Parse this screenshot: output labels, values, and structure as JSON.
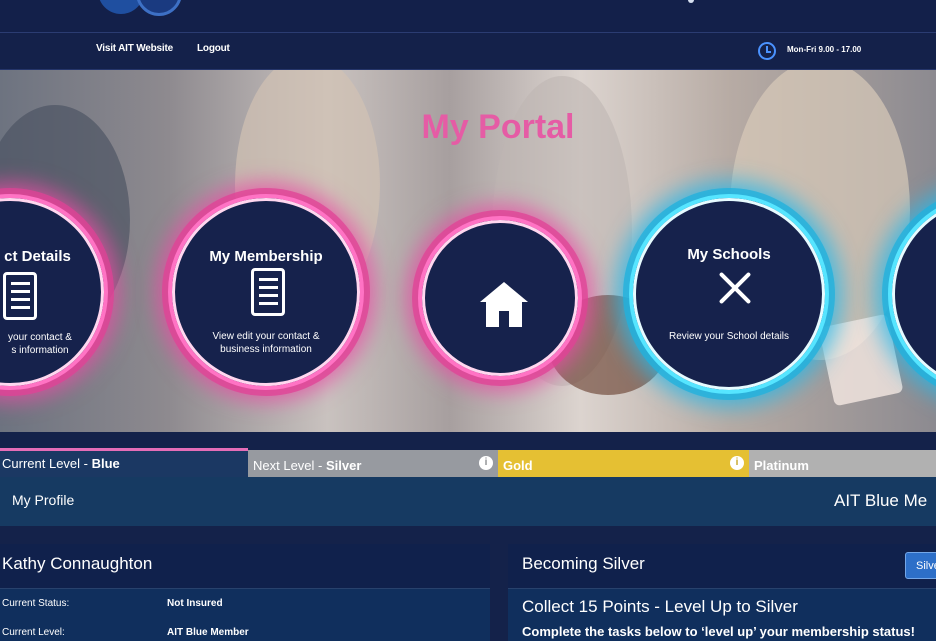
{
  "header": {
    "nav": [
      "Visit AIT Website",
      "Logout"
    ],
    "hours": "Mon-Fri 9.00 - 17.00"
  },
  "hero": {
    "title": "My Portal",
    "cards": [
      {
        "name": "contact-details",
        "title": "ct Details",
        "desc": "your contact &\ns information"
      },
      {
        "name": "my-membership",
        "title": "My Membership",
        "desc": "View edit your contact &\nbusiness information"
      },
      {
        "name": "home",
        "title": "",
        "desc": ""
      },
      {
        "name": "my-schools",
        "title": "My Schools",
        "desc": "Review your School details"
      }
    ]
  },
  "levels": {
    "current_label": "Current Level - ",
    "current_value": "Blue",
    "next_label": "Next Level - ",
    "next_value": "Silver",
    "gold": "Gold",
    "platinum": "Platinum",
    "info_icon": "i"
  },
  "profile": {
    "label": "My Profile",
    "member_label": "AIT Blue Me"
  },
  "left_panel": {
    "name": "Kathy Connaughton",
    "rows": [
      {
        "key": "Current Status:",
        "value": "Not Insured"
      },
      {
        "key": "Current Level:",
        "value": "AIT Blue Member"
      }
    ]
  },
  "right_panel": {
    "title": "Becoming Silver",
    "button": "Silve",
    "collect": "Collect 15 Points - Level Up to Silver",
    "note": "Complete the tasks below to ‘level up’ your membership status!"
  },
  "colors": {
    "navy": "#14224a",
    "pink": "#e55ca5",
    "cyan": "#56e5ff",
    "gold": "#e5c033"
  }
}
